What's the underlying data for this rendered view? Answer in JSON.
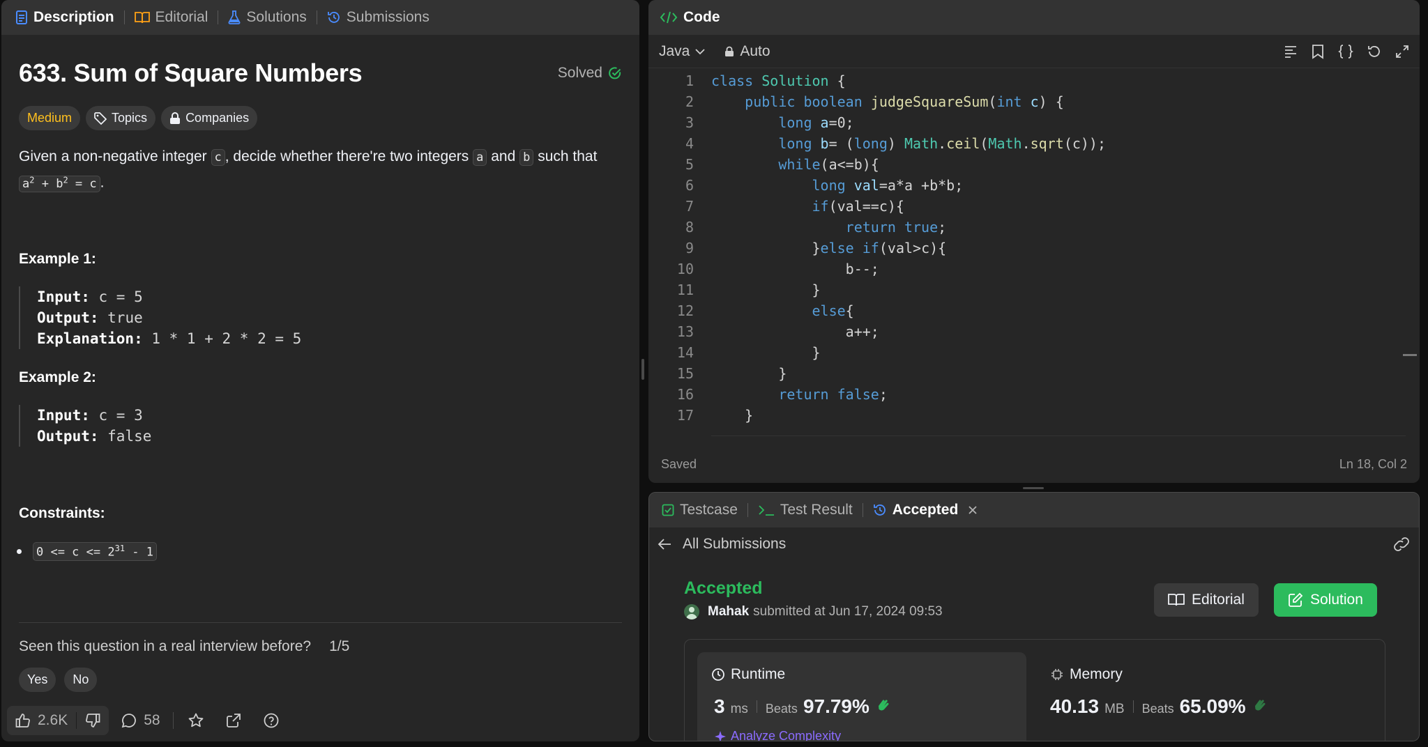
{
  "left": {
    "tabs": [
      {
        "label": "Description"
      },
      {
        "label": "Editorial"
      },
      {
        "label": "Solutions"
      },
      {
        "label": "Submissions"
      }
    ],
    "title": "633. Sum of Square Numbers",
    "solved_label": "Solved",
    "tags": {
      "difficulty": "Medium",
      "topics": "Topics",
      "companies": "Companies"
    },
    "statement": {
      "p1": "Given a non-negative integer ",
      "c": "c",
      "p2": ", decide whether there're two integers ",
      "a": "a",
      "p3": " and ",
      "b": "b",
      "p4": " such that",
      "eq_a": "a",
      "eq_sup1": "2",
      "eq_plus": " + b",
      "eq_sup2": "2",
      "eq_rest": " = c",
      "p5": "."
    },
    "example1": {
      "heading": "Example 1:",
      "input_label": "Input:",
      "input_value": " c = 5",
      "output_label": "Output:",
      "output_value": " true",
      "explanation_label": "Explanation:",
      "explanation_value": " 1 * 1 + 2 * 2 = 5"
    },
    "example2": {
      "heading": "Example 2:",
      "input_label": "Input:",
      "input_value": " c = 3",
      "output_label": "Output:",
      "output_value": " false"
    },
    "constraints": {
      "heading": "Constraints:",
      "item_pre": "0 <= c <= 2",
      "item_sup": "31",
      "item_post": " - 1"
    },
    "interview": {
      "question": "Seen this question in a real interview before?",
      "count": "1/5",
      "yes": "Yes",
      "no": "No"
    },
    "footer": {
      "likes": "2.6K",
      "comments": "58"
    }
  },
  "code": {
    "tab_label": "Code",
    "language": "Java",
    "mode": "Auto",
    "status_left": "Saved",
    "status_right": "Ln 18, Col 2",
    "line_numbers": [
      "1",
      "2",
      "3",
      "4",
      "5",
      "6",
      "7",
      "8",
      "9",
      "10",
      "11",
      "12",
      "13",
      "14",
      "15",
      "16",
      "17"
    ]
  },
  "result": {
    "tabs": {
      "testcase": "Testcase",
      "test_result": "Test Result",
      "accepted": "Accepted"
    },
    "back_label": "All Submissions",
    "status": "Accepted",
    "user": "Mahak",
    "submitted_text": " submitted at Jun 17, 2024 09:53",
    "editorial_btn": "Editorial",
    "solution_btn": "Solution",
    "runtime": {
      "label": "Runtime",
      "value": "3",
      "unit": "ms",
      "beats_label": "Beats",
      "beats_value": "97.79%"
    },
    "memory": {
      "label": "Memory",
      "value": "40.13",
      "unit": "MB",
      "beats_label": "Beats",
      "beats_value": "65.09%"
    },
    "analyze_label": "Analyze Complexity"
  },
  "colors": {
    "accent_green": "#2cbb5d",
    "medium": "#ffc01e",
    "accepted": "#2cbb5d",
    "link_blue": "#4a8cff"
  }
}
